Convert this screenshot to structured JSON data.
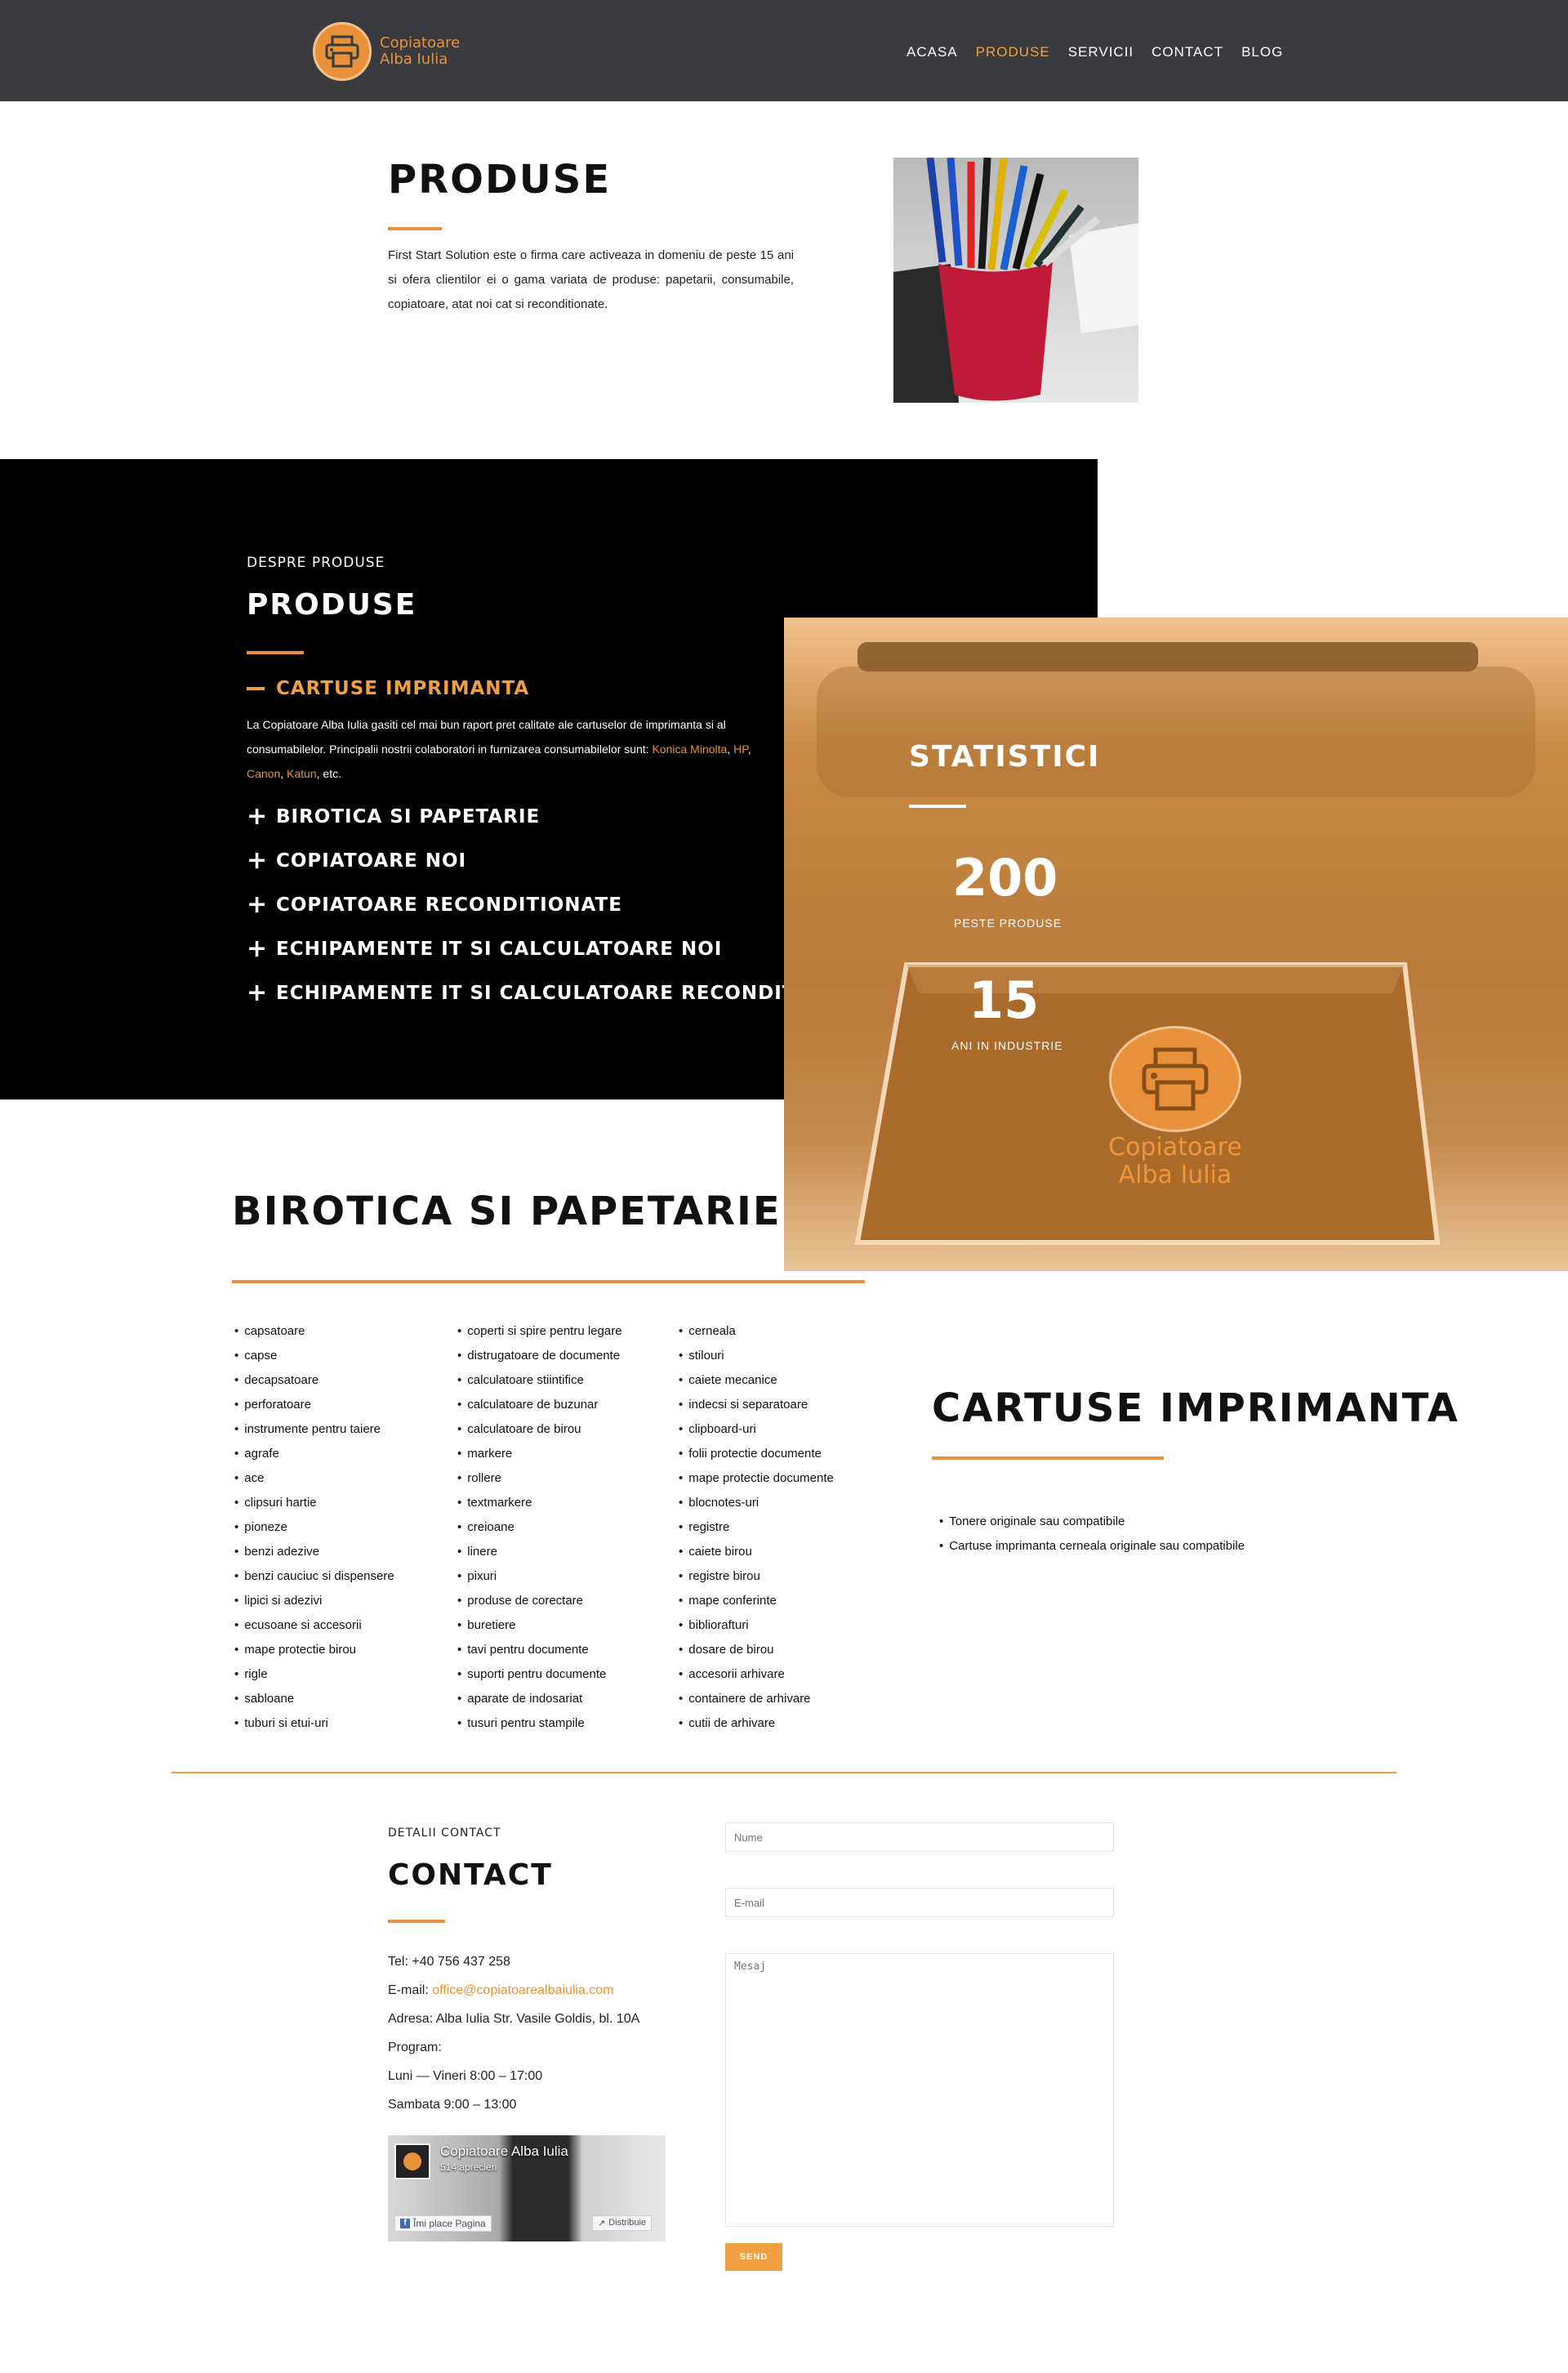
{
  "header": {
    "logo_line1": "Copiatoare",
    "logo_line2": "Alba Iulia",
    "nav": [
      {
        "label": "ACASA",
        "active": false
      },
      {
        "label": "PRODUSE",
        "active": true
      },
      {
        "label": "SERVICII",
        "active": false
      },
      {
        "label": "CONTACT",
        "active": false
      },
      {
        "label": "BLOG",
        "active": false
      }
    ],
    "accent_color": "#f0a040"
  },
  "hero": {
    "title": "PRODUSE",
    "text": "First Start Solution este o firma care activeaza in domeniu de peste 15 ani si ofera clientilor ei o gama variata de produse: papetarii, consumabile, copiatoare, atat noi cat si reconditionate."
  },
  "despre": {
    "kicker": "DESPRE PRODUSE",
    "title": "PRODUSE",
    "open_item": {
      "title": "CARTUSE IMPRIMANTA",
      "text_before": "La Copiatoare Alba Iulia gasiti cel mai bun raport pret calitate ale cartuselor de imprimanta si al consumabilelor. Principalii nostrii colaboratori in furnizarea consumabilelor sunt: ",
      "link1": "Konica Minolta",
      "link2": "HP",
      "link3": "Canon",
      "link4": "Katun",
      "text_after": ", etc."
    },
    "items": [
      "BIROTICA SI PAPETARIE",
      "COPIATOARE NOI",
      "COPIATOARE RECONDITIONATE",
      "ECHIPAMENTE IT SI CALCULATOARE NOI",
      "ECHIPAMENTE IT SI CALCULATOARE RECONDITIONATE"
    ]
  },
  "stats": {
    "title": "STATISTICI",
    "stat1_value": "200",
    "stat1_label": "PESTE PRODUSE",
    "stat2_value": "15",
    "stat2_label": "ANI IN INDUSTRIE",
    "logo_line1": "Copiatoare",
    "logo_line2": "Alba Iulia"
  },
  "birotica": {
    "title": "BIROTICA SI PAPETARIE",
    "col1": [
      "capsatoare",
      "capse",
      "decapsatoare",
      "perforatoare",
      "instrumente pentru taiere",
      "agrafe",
      "ace",
      "clipsuri hartie",
      "pioneze",
      "benzi adezive",
      "benzi cauciuc si dispensere",
      "lipici si adezivi",
      "ecusoane si accesorii",
      "mape protectie birou",
      "rigle",
      "sabloane",
      "tuburi si etui-uri"
    ],
    "col2": [
      "coperti si spire pentru legare",
      "distrugatoare de documente",
      "calculatoare stiintifice",
      "calculatoare de buzunar",
      "calculatoare de birou",
      "markere",
      "rollere",
      "textmarkere",
      "creioane",
      "linere",
      "pixuri",
      "produse de corectare",
      "buretiere",
      "tavi pentru documente",
      "suporti pentru documente",
      "aparate de indosariat",
      "tusuri pentru stampile"
    ],
    "col3": [
      "cerneala",
      "stilouri",
      "caiete mecanice",
      "indecsi si separatoare",
      "clipboard-uri",
      "folii protectie documente",
      "mape protectie documente",
      "blocnotes-uri",
      "registre",
      "caiete birou",
      "registre birou",
      "mape conferinte",
      "bibliorafturi",
      "dosare de birou",
      "accesorii arhivare",
      "containere de arhivare",
      "cutii de arhivare"
    ]
  },
  "cartuse": {
    "title": "CARTUSE IMPRIMANTA",
    "items": [
      "Tonere originale sau compatibile",
      "Cartuse imprimanta cerneala originale sau compatibile"
    ]
  },
  "contact": {
    "kicker": "DETALII CONTACT",
    "title": "CONTACT",
    "tel": "Tel: +40 756 437 258",
    "email_label": "E-mail: ",
    "email": "office@copiatoarealbaiulia.com",
    "address": "Adresa: Alba Iulia Str. Vasile Goldis, bl. 10A",
    "program_label": "Program:",
    "program1": "Luni — Vineri 8:00 – 17:00",
    "program2": "Sambata 9:00 – 13:00",
    "fb_page": "Copiatoare Alba Iulia",
    "fb_likes": "514 aprecieri",
    "fb_like_btn": "Îmi place Pagina",
    "fb_share_btn": "Distribuie",
    "form": {
      "name_placeholder": "Nume",
      "email_placeholder": "E-mail",
      "message_placeholder": "Mesaj",
      "send_label": "SEND"
    }
  }
}
